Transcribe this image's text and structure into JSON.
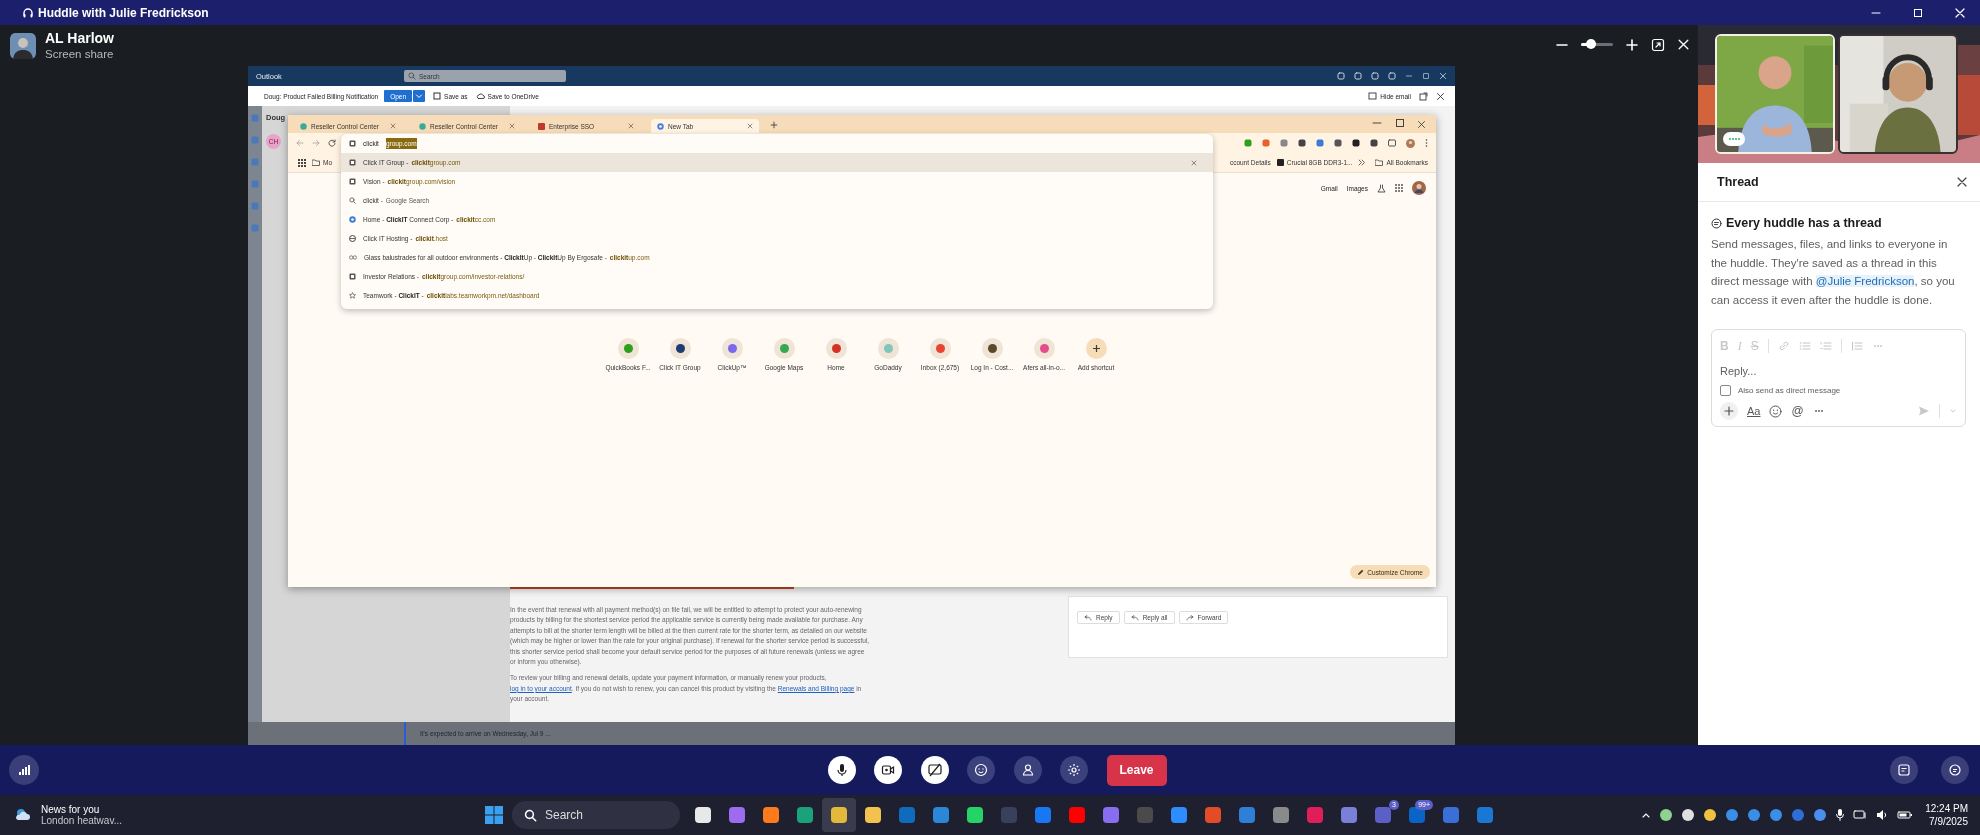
{
  "title_bar": {
    "title": "Huddle with Julie Fredrickson"
  },
  "presenter": {
    "name": "AL Harlow",
    "subtitle": "Screen share"
  },
  "zoom_slider": {
    "level": 0.3
  },
  "shared_screen": {
    "outlook": {
      "app_name": "Outlook",
      "search_placeholder": "Search",
      "email_subject": "Doug: Product Failed Billing Notification",
      "open_button": "Open",
      "save_as": "Save as",
      "save_onedrive": "Save to OneDrive",
      "hide_email": "Hide email",
      "sender_fragment": "Doug",
      "avatar_initials": "CH",
      "paragraphs": [
        [
          {
            "text": "In the event that renewal with all payment method(s) on file fail, we will be entitled to attempt to protect your auto-renewing products by billing for the shortest service period the applicable service is currently being made available for purchase. Any attempts to bill at the shorter term length will be billed at the then current rate for the shorter term, as detailed on our website (which may be higher or lower than the rate for your original purchase). If renewal for the shorter service period is successful, this shorter service period shall become your default service period for the purposes of all future renewals (unless we agree or inform you otherwise).",
            "kind": "text"
          }
        ],
        [
          {
            "text": "To review your billing and renewal details, update your payment information, or manually renew your products, ",
            "kind": "text"
          },
          {
            "text": "log in to your account",
            "kind": "link"
          },
          {
            "text": ". If you do not wish to renew, you can cancel this product by visiting the ",
            "kind": "text"
          },
          {
            "text": "Renewals and Billing page",
            "kind": "link"
          },
          {
            "text": " in your account.",
            "kind": "text"
          }
        ]
      ],
      "reply_buttons": [
        "Reply",
        "Reply all",
        "Forward"
      ],
      "list_preview": "It's expected to arrive on Wednesday, Jul 9 ..."
    },
    "chrome": {
      "tabs": [
        {
          "title": "Reseller Control Center",
          "kind": "site",
          "selected": false
        },
        {
          "title": "Reseller Control Center",
          "kind": "site",
          "selected": false
        },
        {
          "title": "Enterprise SSO",
          "kind": "sso",
          "selected": false
        },
        {
          "title": "New Tab",
          "kind": "newtab",
          "selected": true
        }
      ],
      "address": {
        "typed": "clickit",
        "completion": "group.com"
      },
      "suggestions": [
        {
          "kind": "page",
          "title": "Click IT Group -",
          "url": "**clickit**group.com",
          "selected": true
        },
        {
          "kind": "page",
          "title": "Vision -",
          "url": "**clickit**group.com/vision",
          "selected": false
        },
        {
          "kind": "search",
          "title": "clickit -",
          "url": "Google Search",
          "selected": false
        },
        {
          "kind": "site",
          "title": "Home - **ClickIT** Connect Corp -",
          "url": "**clickit**cc.com",
          "selected": false
        },
        {
          "kind": "hosting",
          "title": "Click IT Hosting -",
          "url": "**clickit**.host",
          "selected": false
        },
        {
          "kind": "link",
          "title": "Glass balustrades for all outdoor environments - **ClickIt**Up - **ClickIt**Up By Ergosafe -",
          "url": "**clickit**up.com",
          "selected": false
        },
        {
          "kind": "page",
          "title": "Investor Relations -",
          "url": "**clickit**group.com/investor-relations/",
          "selected": false
        },
        {
          "kind": "star",
          "title": "Teamwork - **ClickIT** -",
          "url": "**clickit**labs.teamworkpm.net/dashboard",
          "selected": false
        }
      ],
      "bookmarks_left": [
        "Mo"
      ],
      "bookmarks_right": [
        "ccount Details",
        "Crucial 8GB DDR3-1..."
      ],
      "all_bookmarks": "All Bookmarks",
      "header_links": [
        "Gmail",
        "Images"
      ],
      "shortcuts": [
        {
          "label": "QuickBooks F...",
          "kind": "site"
        },
        {
          "label": "Click IT Group",
          "kind": "site"
        },
        {
          "label": "ClickUp™",
          "kind": "site"
        },
        {
          "label": "Google Maps",
          "kind": "site"
        },
        {
          "label": "Home",
          "kind": "site"
        },
        {
          "label": "GoDaddy",
          "kind": "site"
        },
        {
          "label": "Inbox (2,675)",
          "kind": "site"
        },
        {
          "label": "Log In - Cost...",
          "kind": "site"
        },
        {
          "label": "Afers all-in-o...",
          "kind": "site"
        },
        {
          "label": "Add shortcut",
          "kind": "add"
        }
      ],
      "customize_button": "Customize Chrome"
    }
  },
  "video_tiles": [
    {
      "speaking": true
    },
    {
      "speaking": false
    }
  ],
  "thread": {
    "title": "Thread",
    "heading": "Every huddle has a thread",
    "description_before": "Send messages, files, and links to everyone in the huddle. They're saved as a thread in this direct message with ",
    "mention": "@Julie Fredrickson",
    "description_after": ", so you can access it even after the huddle is done.",
    "composer": {
      "format_marks": [
        "B",
        "I",
        "S"
      ],
      "placeholder": "Reply...",
      "also_send_label": "Also send as direct message",
      "also_send_checked": false,
      "text_style_mark": "Aa",
      "mention_mark": "@"
    }
  },
  "call_controls": [
    {
      "kind": "mic",
      "on": true
    },
    {
      "kind": "video",
      "on": true
    },
    {
      "kind": "screen",
      "on": true
    },
    {
      "kind": "emoji",
      "on": false
    },
    {
      "kind": "people",
      "on": false
    },
    {
      "kind": "settings",
      "on": false
    }
  ],
  "leave_button": "Leave",
  "taskbar": {
    "news_title": "News for you",
    "news_subtitle": "London heatwav...",
    "search_placeholder": "Search",
    "apps": [
      {
        "color": "#e8e8e8",
        "active": false
      },
      {
        "color": "#9b6cf0",
        "active": false
      },
      {
        "color": "#ff7a1a",
        "active": false
      },
      {
        "color": "#1aa37a",
        "active": false
      },
      {
        "color": "#e2b93b",
        "active": true
      },
      {
        "color": "#f2c14e",
        "active": false
      },
      {
        "color": "#0f6cbd",
        "active": false
      },
      {
        "color": "#2b88d8",
        "active": false
      },
      {
        "color": "#25d366",
        "active": false
      },
      {
        "color": "#3a3f5c",
        "active": false
      },
      {
        "color": "#1877f2",
        "active": false
      },
      {
        "color": "#ff0000",
        "active": false
      },
      {
        "color": "#8a6cf0",
        "active": false
      },
      {
        "color": "#4a4a4a",
        "active": false
      },
      {
        "color": "#2d8cff",
        "active": false
      },
      {
        "color": "#e34c26",
        "active": false
      },
      {
        "color": "#2f7fd8",
        "active": false
      },
      {
        "color": "#8a8a8a",
        "active": false
      },
      {
        "color": "#e01e5a",
        "active": false
      },
      {
        "color": "#7a7fd8",
        "active": false
      },
      {
        "color": "#5b5fc7",
        "active": false,
        "badge": "3"
      },
      {
        "color": "#0a64c8",
        "active": false,
        "badge": "99+"
      },
      {
        "color": "#3a6fd8",
        "active": false
      },
      {
        "color": "#1a78d4",
        "active": false
      }
    ],
    "time": "12:24 PM",
    "date": "7/9/2025"
  }
}
